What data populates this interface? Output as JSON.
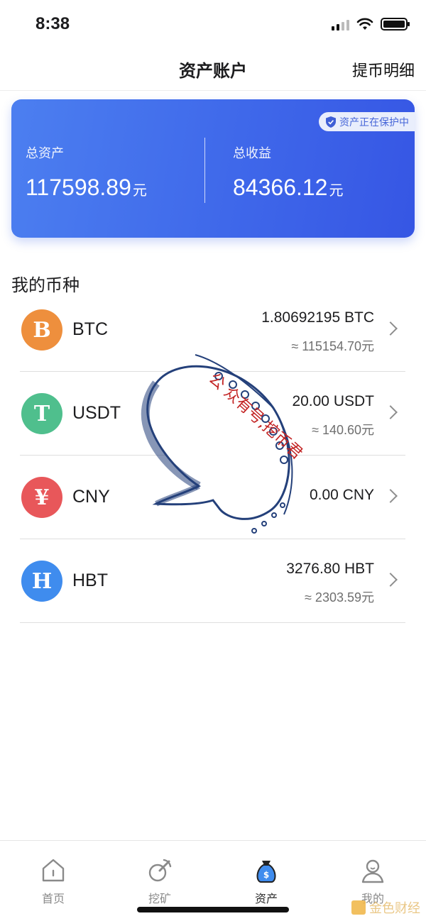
{
  "status": {
    "time": "8:38"
  },
  "nav": {
    "title": "资产账户",
    "right_link": "提币明细"
  },
  "asset_card": {
    "protect_badge": "资产正在保护中",
    "total_assets_label": "总资产",
    "total_assets_value": "117598.89",
    "total_assets_unit": "元",
    "total_income_label": "总收益",
    "total_income_value": "84366.12",
    "total_income_unit": "元",
    "colors": {
      "start": "#4c7ff0",
      "end": "#3656e4"
    }
  },
  "section": {
    "title": "我的币种"
  },
  "coins": [
    {
      "name": "BTC",
      "symbol": "B",
      "amount": "1.80692195 BTC",
      "value": "≈ 115154.70元",
      "color": "#ee8f3d",
      "icon": "bitcoin-icon"
    },
    {
      "name": "USDT",
      "symbol": "T",
      "amount": "20.00 USDT",
      "value": "≈ 140.60元",
      "color": "#4fbf8d",
      "icon": "tether-icon"
    },
    {
      "name": "CNY",
      "symbol": "¥",
      "amount": "0.00 CNY",
      "value": "",
      "color": "#e8575a",
      "icon": "yuan-icon"
    },
    {
      "name": "HBT",
      "symbol": "H",
      "amount": "3276.80 HBT",
      "value": "≈ 2303.59元",
      "color": "#3f8cee",
      "icon": "hbt-icon"
    }
  ],
  "watermark": {
    "text": "公 众有号,挖币君",
    "corner": "金色财经"
  },
  "tabs": [
    {
      "label": "首页",
      "icon": "home-icon",
      "active": false
    },
    {
      "label": "挖矿",
      "icon": "pickaxe-icon",
      "active": false
    },
    {
      "label": "资产",
      "icon": "money-bag-icon",
      "active": true
    },
    {
      "label": "我的",
      "icon": "profile-icon",
      "active": false
    }
  ]
}
